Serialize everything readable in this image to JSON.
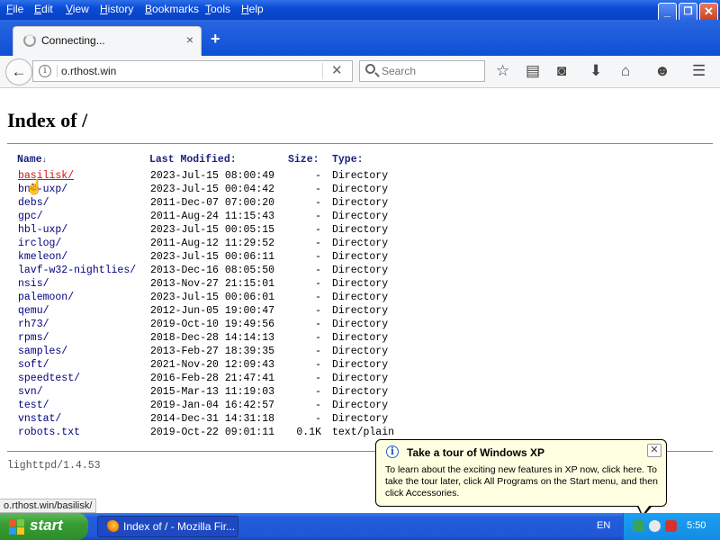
{
  "menubar": {
    "items": [
      "File",
      "Edit",
      "View",
      "History",
      "Bookmarks",
      "Tools",
      "Help"
    ],
    "accesskeys": [
      "F",
      "E",
      "V",
      "H",
      "B",
      "T",
      "H"
    ],
    "window_buttons": [
      "minimize",
      "restore",
      "close"
    ]
  },
  "tab": {
    "title": "Connecting...",
    "close_glyph": "×",
    "new_tab_glyph": "+"
  },
  "navbar": {
    "back_glyph": "←",
    "url": "o.rthost.win",
    "url_clear_glyph": "✕",
    "search_placeholder": "Search",
    "icons": [
      "bookmark-star-icon",
      "reading-list-icon",
      "pocket-icon",
      "download-icon",
      "home-icon",
      "smiley-icon",
      "hamburger-menu-icon"
    ]
  },
  "page": {
    "heading": "Index of /",
    "columns": {
      "name": "Name",
      "sort_arrow": "↓",
      "modified": "Last Modified:",
      "size": "Size:",
      "type": "Type:"
    },
    "rows": [
      {
        "name": "basilisk/",
        "modified": "2023-Jul-15 08:00:49",
        "size": "-",
        "type": "Directory"
      },
      {
        "name": "bnl-uxp/",
        "modified": "2023-Jul-15 00:04:42",
        "size": "-",
        "type": "Directory"
      },
      {
        "name": "debs/",
        "modified": "2011-Dec-07 07:00:20",
        "size": "-",
        "type": "Directory"
      },
      {
        "name": "gpc/",
        "modified": "2011-Aug-24 11:15:43",
        "size": "-",
        "type": "Directory"
      },
      {
        "name": "hbl-uxp/",
        "modified": "2023-Jul-15 00:05:15",
        "size": "-",
        "type": "Directory"
      },
      {
        "name": "irclog/",
        "modified": "2011-Aug-12 11:29:52",
        "size": "-",
        "type": "Directory"
      },
      {
        "name": "kmeleon/",
        "modified": "2023-Jul-15 00:06:11",
        "size": "-",
        "type": "Directory"
      },
      {
        "name": "lavf-w32-nightlies/",
        "modified": "2013-Dec-16 08:05:50",
        "size": "-",
        "type": "Directory"
      },
      {
        "name": "nsis/",
        "modified": "2013-Nov-27 21:15:01",
        "size": "-",
        "type": "Directory"
      },
      {
        "name": "palemoon/",
        "modified": "2023-Jul-15 00:06:01",
        "size": "-",
        "type": "Directory"
      },
      {
        "name": "qemu/",
        "modified": "2012-Jun-05 19:00:47",
        "size": "-",
        "type": "Directory"
      },
      {
        "name": "rh73/",
        "modified": "2019-Oct-10 19:49:56",
        "size": "-",
        "type": "Directory"
      },
      {
        "name": "rpms/",
        "modified": "2018-Dec-28 14:14:13",
        "size": "-",
        "type": "Directory"
      },
      {
        "name": "samples/",
        "modified": "2013-Feb-27 18:39:35",
        "size": "-",
        "type": "Directory"
      },
      {
        "name": "soft/",
        "modified": "2021-Nov-20 12:09:43",
        "size": "-",
        "type": "Directory"
      },
      {
        "name": "speedtest/",
        "modified": "2016-Feb-28 21:47:41",
        "size": "-",
        "type": "Directory"
      },
      {
        "name": "svn/",
        "modified": "2015-Mar-13 11:19:03",
        "size": "-",
        "type": "Directory"
      },
      {
        "name": "test/",
        "modified": "2019-Jan-04 16:42:57",
        "size": "-",
        "type": "Directory"
      },
      {
        "name": "vnstat/",
        "modified": "2014-Dec-31 14:31:18",
        "size": "-",
        "type": "Directory"
      },
      {
        "name": "robots.txt",
        "modified": "2019-Oct-22 09:01:11",
        "size": "0.1K",
        "type": "text/plain"
      }
    ],
    "server_signature": "lighttpd/1.4.53"
  },
  "statusbar": {
    "text": "o.rthost.win/basilisk/"
  },
  "balloon": {
    "info_glyph": "i",
    "title": "Take a tour of Windows XP",
    "close_glyph": "✕",
    "body": "To learn about the exciting new features in XP now, click here. To take the tour later, click All Programs on the Start menu, and then click Accessories."
  },
  "taskbar": {
    "start_label": "start",
    "task_label": "Index of / - Mozilla Fir...",
    "language": "EN",
    "clock": "5:50"
  },
  "colors": {
    "xp_blue": "#245edb",
    "start_green": "#379e33",
    "link_blue": "#000080",
    "hover_red": "#d01010",
    "balloon_bg": "#ffffe1"
  }
}
